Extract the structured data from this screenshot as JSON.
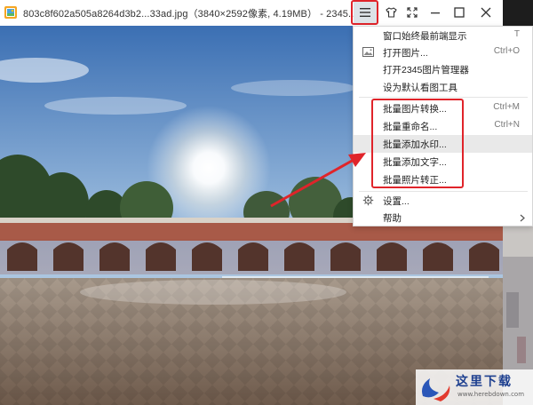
{
  "window": {
    "title": "803c8f602a505a8264d3b2...33ad.jpg（3840×2592像素, 4.19MB） - 2345..."
  },
  "toolbar": {
    "menu_icon": "hamburger-icon",
    "skin_icon": "tshirt-icon",
    "fullscreen_icon": "expand-icon",
    "minimize_icon": "minimize-icon",
    "maximize_icon": "maximize-icon",
    "close_icon": "close-icon"
  },
  "menu": {
    "items": [
      {
        "label": "窗口始终最前端显示",
        "shortcut": "T"
      },
      {
        "label": "打开图片...",
        "shortcut": "Ctrl+O",
        "icon": "image-icon"
      },
      {
        "label": "打开2345图片管理器",
        "shortcut": ""
      },
      {
        "label": "设为默认看图工具",
        "shortcut": ""
      },
      {
        "label": "批量图片转换...",
        "shortcut": "Ctrl+M"
      },
      {
        "label": "批量重命名...",
        "shortcut": "Ctrl+N"
      },
      {
        "label": "批量添加水印...",
        "shortcut": ""
      },
      {
        "label": "批量添加文字...",
        "shortcut": ""
      },
      {
        "label": "批量照片转正...",
        "shortcut": ""
      },
      {
        "label": "设置...",
        "shortcut": "",
        "icon": "gear-icon"
      },
      {
        "label": "帮助",
        "shortcut": "",
        "submenu": true
      }
    ]
  },
  "watermark": {
    "brand": "这里下载",
    "url": "www.herebdown.com"
  },
  "colors": {
    "highlight_red": "#e0242a",
    "menu_hover": "#e9e9e9"
  }
}
